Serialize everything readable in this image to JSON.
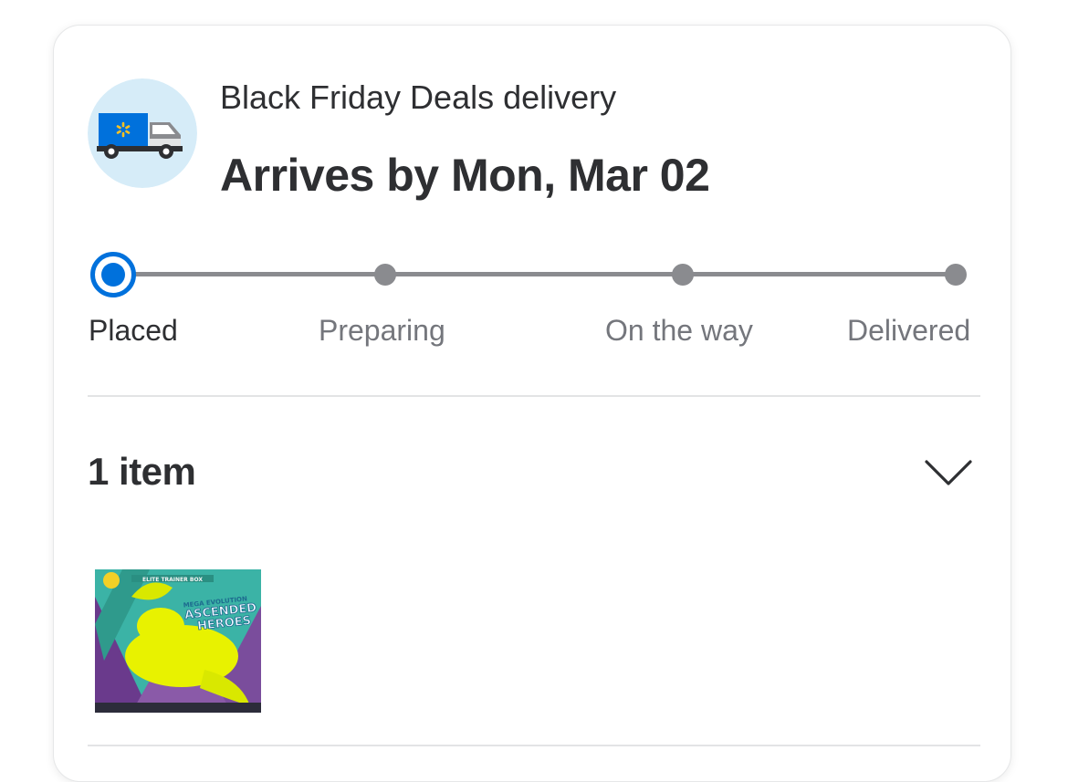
{
  "delivery": {
    "subtitle": "Black Friday Deals delivery",
    "headline": "Arrives by Mon, Mar 02",
    "icon": "delivery-truck-icon"
  },
  "tracker": {
    "current_step": 0,
    "steps": [
      {
        "label": "Placed"
      },
      {
        "label": "Preparing"
      },
      {
        "label": "On the way"
      },
      {
        "label": "Delivered"
      }
    ],
    "active_color": "#0071dc",
    "inactive_color": "#8a8b8f"
  },
  "items": {
    "count_label": "1 item",
    "toggle_icon": "chevron-down-icon",
    "products": [
      {
        "image": "product-image",
        "box_title": "ELITE TRAINER BOX",
        "art_text": [
          "MEGA EVOLUTION",
          "ASCENDED",
          "HEROES"
        ]
      }
    ]
  },
  "colors": {
    "text_primary": "#2e2f32",
    "text_secondary": "#74767c",
    "brand_blue": "#0071dc",
    "avatar_bg": "#d6ecf8"
  }
}
